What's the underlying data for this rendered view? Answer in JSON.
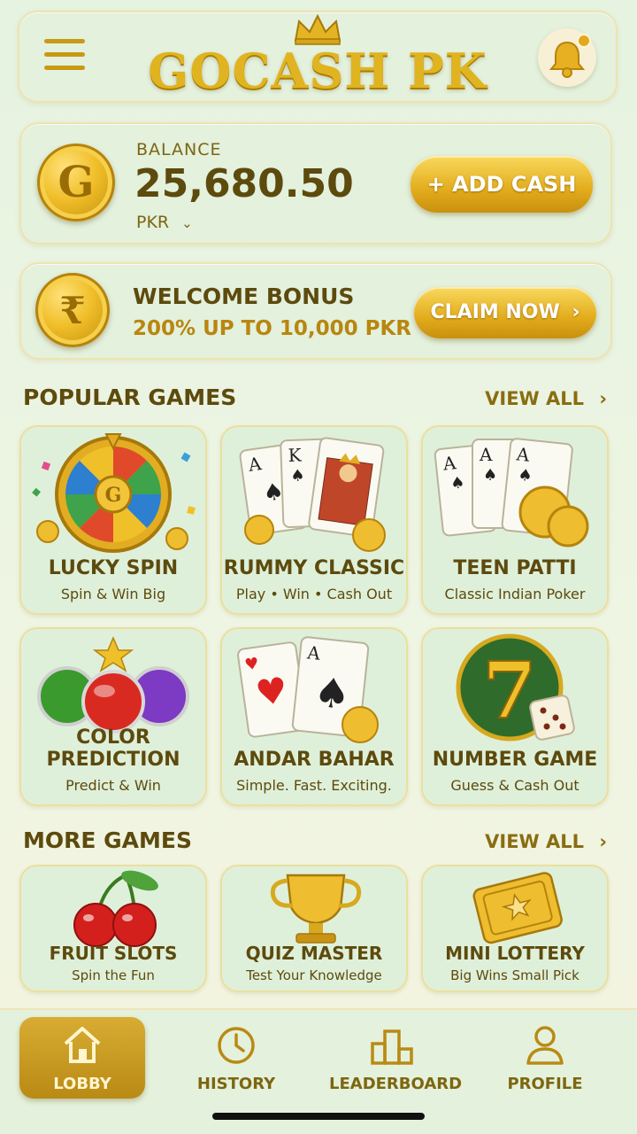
{
  "header": {
    "title": "GOCASH PK",
    "menu_icon": "hamburger-menu-icon",
    "bell_icon": "bell-icon"
  },
  "balance": {
    "label": "BALANCE",
    "amount": "25,680.50",
    "currency": "PKR",
    "coin_letter": "G",
    "add_button": "+ ADD CASH"
  },
  "bonus": {
    "title": "WELCOME BONUS",
    "subtitle": "200% UP TO 10,000 PKR",
    "coin_symbol": "₹",
    "button": "CLAIM NOW"
  },
  "popular": {
    "title": "POPULAR GAMES",
    "view_all": "VIEW ALL",
    "games": [
      {
        "name": "LUCKY SPIN",
        "sub": "Spin & Win Big"
      },
      {
        "name": "RUMMY CLASSIC",
        "sub": "Play • Win • Cash Out"
      },
      {
        "name": "TEEN PATTI",
        "sub": "Classic Indian Poker"
      },
      {
        "name": "COLOR PREDICTION",
        "sub": "Predict & Win"
      },
      {
        "name": "ANDAR BAHAR",
        "sub": "Simple. Fast. Exciting."
      },
      {
        "name": "NUMBER GAME",
        "sub": "Guess & Cash Out"
      }
    ]
  },
  "more": {
    "title": "MORE GAMES",
    "view_all": "VIEW ALL",
    "games": [
      {
        "name": "FRUIT SLOTS",
        "sub": "Spin the Fun"
      },
      {
        "name": "QUIZ MASTER",
        "sub": "Test Your Knowledge"
      },
      {
        "name": "MINI LOTTERY",
        "sub": "Big Wins Small Pick"
      }
    ]
  },
  "nav": [
    {
      "label": "LOBBY",
      "icon": "home-icon",
      "active": true
    },
    {
      "label": "HISTORY",
      "icon": "clock-icon",
      "active": false
    },
    {
      "label": "LEADERBOARD",
      "icon": "podium-icon",
      "active": false
    },
    {
      "label": "PROFILE",
      "icon": "user-icon",
      "active": false
    }
  ],
  "colors": {
    "gold": "#e0b320",
    "dark_text": "#5d4a0d",
    "background": "#e6f3e1"
  }
}
